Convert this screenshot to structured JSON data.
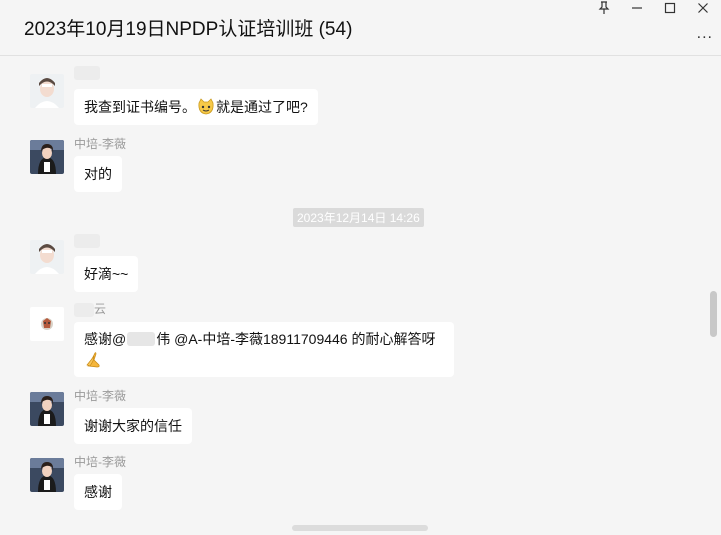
{
  "window": {
    "title": "2023年10月19日NPDP认证培训班 (54)",
    "more_label": "...",
    "pin_icon": "pin-icon",
    "minimize_icon": "minimize-icon",
    "maximize_icon": "maximize-icon",
    "close_icon": "close-icon"
  },
  "messages": [
    {
      "sender": "",
      "text": "我查到证书编号。",
      "emoji": "cat-face-emoji",
      "text_after": "就是通过了吧?"
    },
    {
      "sender": "中培-李薇",
      "text": "对的"
    },
    {
      "timestamp": "2023年12月14日 14:26"
    },
    {
      "sender": "",
      "text": "好滴~~"
    },
    {
      "sender": "云",
      "text_part1": "感谢@",
      "text_part2": "伟 @A-中培-李薇18911709446 的耐心解答呀",
      "emoji": "folded-hands-emoji"
    },
    {
      "sender": "中培-李薇",
      "text": "谢谢大家的信任"
    },
    {
      "sender": "中培-李薇",
      "text": "感谢"
    }
  ],
  "colors": {
    "background": "#f5f5f5",
    "bubble": "#ffffff",
    "sender_text": "#9a9a9a",
    "timestamp_bg": "#dadada"
  }
}
